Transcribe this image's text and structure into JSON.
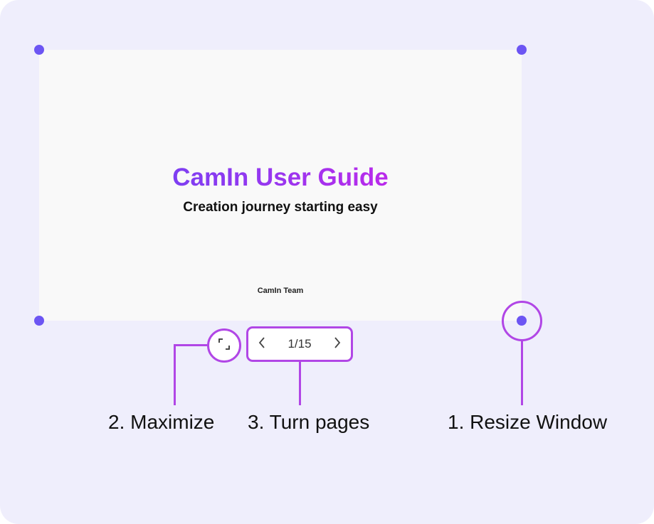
{
  "slide": {
    "title": "CamIn User Guide",
    "subtitle": "Creation journey starting easy",
    "author": "CamIn Team"
  },
  "pager": {
    "page_indicator": "1/15"
  },
  "callouts": {
    "maximize": "2. Maximize",
    "turn_pages": "3. Turn pages",
    "resize_window": "1. Resize Window"
  },
  "colors": {
    "background": "#efeefc",
    "accent": "#b146e6",
    "handle": "#6c55f3",
    "title_gradient": [
      "#5b49f5",
      "#e21be6"
    ]
  },
  "icons": {
    "maximize": "maximize-icon",
    "prev": "chevron-left-icon",
    "next": "chevron-right-icon"
  }
}
